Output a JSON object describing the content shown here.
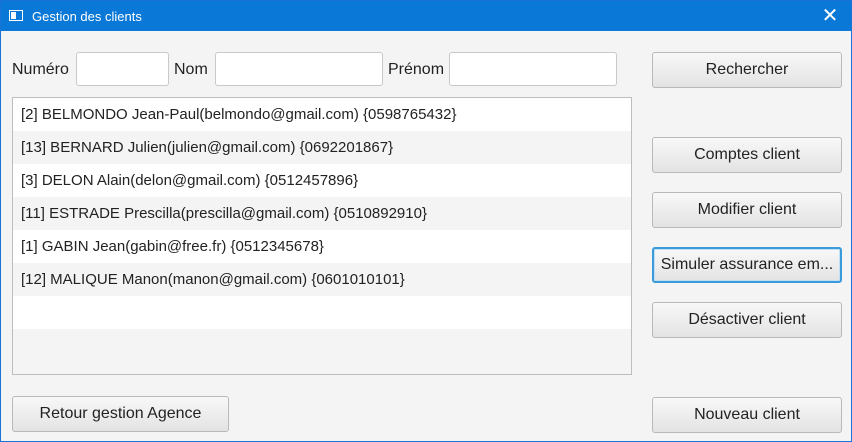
{
  "window": {
    "title": "Gestion des clients",
    "close_glyph": "✕",
    "icon": "window-app-icon"
  },
  "search": {
    "numero_label": "Numéro",
    "nom_label": "Nom",
    "prenom_label": "Prénom",
    "numero_value": "",
    "nom_value": "",
    "prenom_value": ""
  },
  "clients": [
    "[2]  BELMONDO Jean-Paul(belmondo@gmail.com)  {0598765432}",
    "[13]  BERNARD Julien(julien@gmail.com)  {0692201867}",
    "[3]  DELON Alain(delon@gmail.com)  {0512457896}",
    "[11]  ESTRADE Prescilla(prescilla@gmail.com)  {0510892910}",
    "[1]  GABIN Jean(gabin@free.fr)  {0512345678}",
    "[12]  MALIQUE Manon(manon@gmail.com)  {0601010101}",
    "",
    ""
  ],
  "buttons": {
    "rechercher": "Rechercher",
    "comptes_client": "Comptes client",
    "modifier_client": "Modifier client",
    "simuler_assurance": "Simuler assurance em...",
    "desactiver_client": "Désactiver client",
    "retour": "Retour gestion Agence",
    "nouveau_client": "Nouveau client"
  }
}
